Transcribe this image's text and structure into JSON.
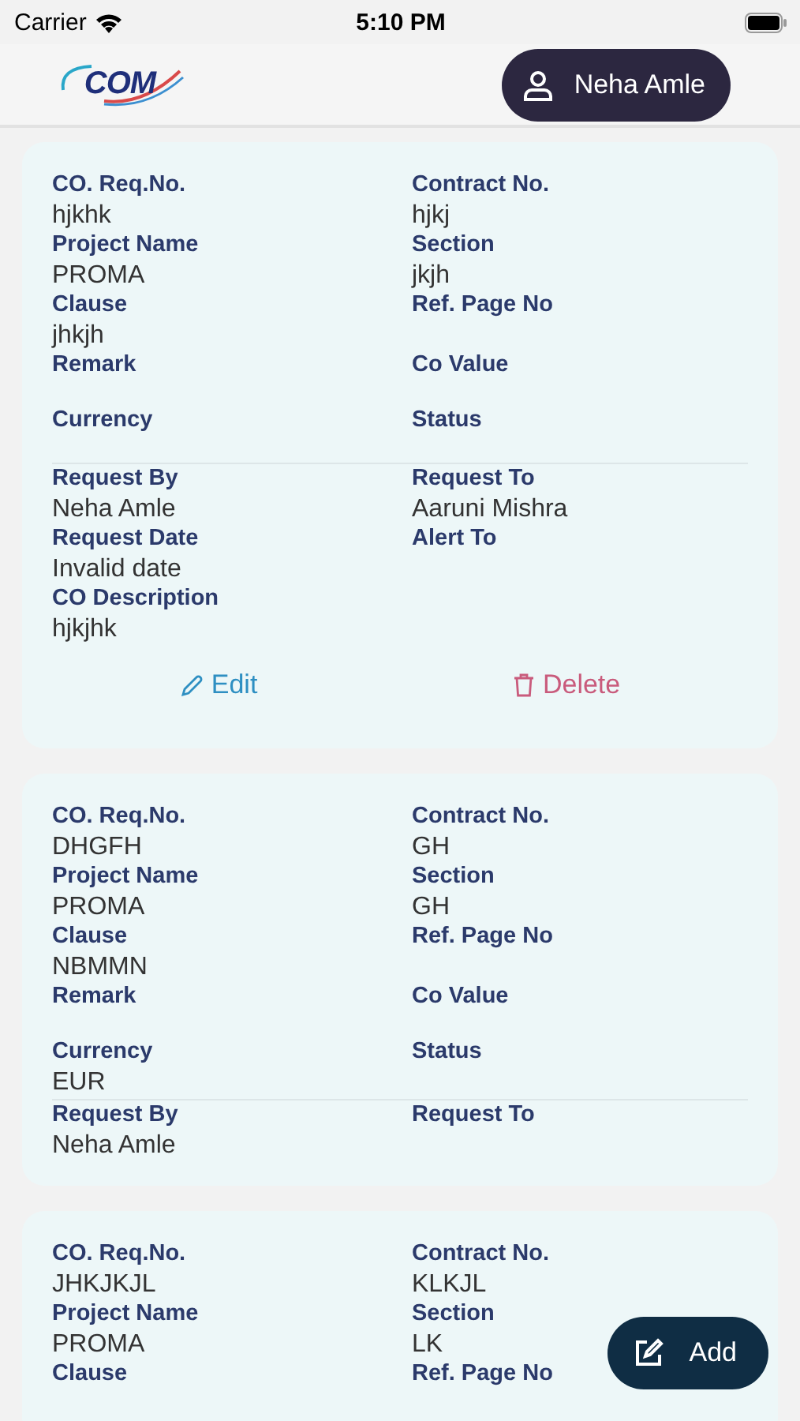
{
  "status_bar": {
    "carrier": "Carrier",
    "time": "5:10 PM"
  },
  "header": {
    "logo": "COM",
    "user": "Neha Amle"
  },
  "cards": [
    {
      "sections": [
        [
          {
            "label": "CO. Req.No.",
            "value": "hjkhk"
          },
          {
            "label": "Contract No.",
            "value": "hjkj"
          },
          {
            "label": "Project Name",
            "value": "PROMA"
          },
          {
            "label": "Section",
            "value": "jkjh"
          },
          {
            "label": "Clause",
            "value": "jhkjh"
          },
          {
            "label": "Ref. Page No"
          },
          {
            "label": "Remark"
          },
          {
            "label": "Co Value"
          },
          {
            "label": "Currency"
          },
          {
            "label": "Status"
          }
        ],
        [
          {
            "label": "Request By",
            "value": "Neha Amle"
          },
          {
            "label": "Request To",
            "value": "Aaruni Mishra"
          },
          {
            "label": "Request Date",
            "value": "Invalid date"
          },
          {
            "label": "Alert To"
          },
          {
            "label": "CO Description",
            "value": "hjkjhk"
          }
        ]
      ],
      "actions": [
        {
          "kind": "edit",
          "label": "Edit"
        },
        {
          "kind": "delete",
          "label": "Delete"
        }
      ]
    },
    {
      "sections": [
        [
          {
            "label": "CO. Req.No.",
            "value": "DHGFH"
          },
          {
            "label": "Contract No.",
            "value": "GH"
          },
          {
            "label": "Project Name",
            "value": "PROMA"
          },
          {
            "label": "Section",
            "value": "GH"
          },
          {
            "label": "Clause",
            "value": "NBMMN"
          },
          {
            "label": "Ref. Page No"
          },
          {
            "label": "Remark"
          },
          {
            "label": "Co Value"
          },
          {
            "label": "Currency",
            "value": "EUR"
          },
          {
            "label": "Status"
          }
        ],
        [
          {
            "label": "Request By",
            "value": "Neha Amle"
          },
          {
            "label": "Request To"
          }
        ]
      ]
    },
    {
      "sections": [
        [
          {
            "label": "CO. Req.No.",
            "value": "JHKJKJL"
          },
          {
            "label": "Contract No.",
            "value": "KLKJL"
          },
          {
            "label": "Project Name",
            "value": "PROMA"
          },
          {
            "label": "Section",
            "value": "LK"
          },
          {
            "label": "Clause"
          },
          {
            "label": "Ref. Page No"
          }
        ]
      ]
    }
  ],
  "add_button": {
    "label": "Add"
  }
}
